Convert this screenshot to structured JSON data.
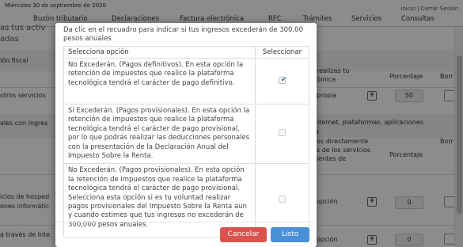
{
  "topbar": {
    "date": "Miércoles 30 de septiembre de 2020",
    "links": "Inicio | Cerrar Sesión"
  },
  "nav": [
    "Buzón tributario",
    "Declaraciones",
    "Factura electrónica",
    "RFC",
    "Trámites",
    "Servicios",
    "Consultas"
  ],
  "background": {
    "heading_fragment_1": "as tus activ",
    "heading_fragment_2": "adas",
    "col_fragment": "ión fiscal",
    "right_header_1": "realizas tu",
    "right_header_2": "ómica",
    "pct_header_1": "Porcentaje",
    "borr_header_1": "Borr",
    "row1_left": "otros servicios",
    "row1_right": "propia",
    "row1_pct": "50",
    "band_left": "ales con ingres",
    "band_right": "nternet, plataformas, aplicaciones",
    "band_right_2": "a",
    "right_header_3": "os directamente",
    "right_header_4": "s de los servicios",
    "right_header_5": "ientes de",
    "pct_header_2": "Porcentaje",
    "borr_header_2": "Borr",
    "row2_left_1": "icios de hosped",
    "row2_left_2": "ones informátic",
    "row2_right": "opción",
    "row2_pct": "0",
    "row3_left": "a través de Inte",
    "row3_right": "opción",
    "row3_pct": "0"
  },
  "modal": {
    "intro": "Da clic en el recuadro para indicar si tus ingresos excederán de 300,00 pesos anuales",
    "col_option": "Selecciona opción",
    "col_select": "Seleccionar",
    "options": [
      {
        "text": "No Excederán. (Pagos definitivos). En esta opción la retención de impuestos que realice la plataforma tecnológica tendrá el carácter de pago definitivo.",
        "checked": true
      },
      {
        "text": "Sí Excederán. (Pagos provisionales). En esta opción la retención de impuestos que realice la plataforma tecnológica tendrá el carácter de pago provisional, por lo que podrás realizar las deducciones personales con la presentación de la Declaración Anual del Impuesto Sobre la Renta.",
        "checked": false
      },
      {
        "text": "No Excederán. (Pagos provisionales). En esta opción la retención de impuestos que realice la plataforma tecnológica tendrá el carácter de pago provisional. Selecciona esta opción si es tu voluntad realizar pagos provisionales del Impuesto Sobre la Renta aun y cuando estimes que tus ingresos no excederán de 300,000 pesos anuales.",
        "checked": false
      }
    ],
    "cancel_label": "Cancelar",
    "ok_label": "Listo"
  },
  "colors": {
    "cancel": "#d9534f",
    "ok": "#4a90d9",
    "check": "#2a4d9b"
  }
}
